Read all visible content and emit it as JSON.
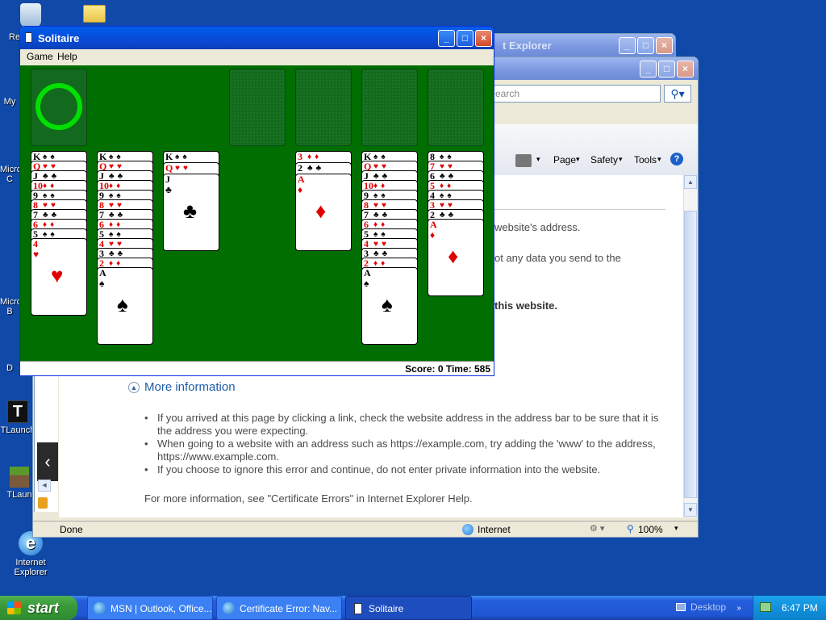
{
  "desktop": {
    "icons": [
      {
        "label": "Re"
      },
      {
        "label": "My"
      },
      {
        "label": "Micro C"
      },
      {
        "label": "Micro B"
      },
      {
        "label": "D"
      },
      {
        "label": "TLaunch"
      },
      {
        "label": "TLaun"
      },
      {
        "label": "Internet Explorer"
      }
    ]
  },
  "ie_back": {
    "title": "t Explorer"
  },
  "ie_front": {
    "search_placeholder": "earch",
    "toolbar": {
      "page": "Page",
      "safety": "Safety",
      "tools": "Tools"
    },
    "content": {
      "line1": "website's address.",
      "line2": "ot any data you send to the",
      "line3": "this website.",
      "more_info": "More information",
      "bullets": [
        "If you arrived at this page by clicking a link, check the website address in the address bar to be sure that it is the address you were expecting.",
        "When going to a website with an address such as https://example.com, try adding the 'www' to the address, https://www.example.com.",
        "If you choose to ignore this error and continue, do not enter private information into the website."
      ],
      "footer": "For more information, see \"Certificate Errors\" in Internet Explorer Help."
    },
    "status": {
      "done": "Done",
      "zone": "Internet",
      "zoom": "100%"
    }
  },
  "solitaire": {
    "title": "Solitaire",
    "menu": [
      "Game",
      "Help"
    ],
    "score": "Score: 0 Time: 585",
    "tableau": [
      [
        "K",
        "Q",
        "J",
        "10",
        "9",
        "8",
        "7",
        "6",
        "5",
        "4"
      ],
      [
        "K",
        "Q",
        "J",
        "10",
        "9",
        "8",
        "7",
        "6",
        "5",
        "4",
        "3",
        "2",
        "A"
      ],
      [
        "K",
        "Q",
        "J"
      ],
      [],
      [
        "3",
        "2",
        "A"
      ],
      [
        "K",
        "Q",
        "J",
        "10",
        "9",
        "8",
        "7",
        "6",
        "5",
        "4",
        "3",
        "2",
        "A"
      ],
      [
        "8",
        "7",
        "6",
        "5",
        "4",
        "3",
        "2",
        "A"
      ]
    ],
    "suit_colors": {
      "red": "#E00000",
      "black": "#000000",
      "felt": "#006E00"
    }
  },
  "taskbar": {
    "start": "start",
    "tasks": [
      "MSN | Outlook, Office...",
      "Certificate Error: Nav...",
      "Solitaire"
    ],
    "desktop_label": "Desktop",
    "clock": "6:47 PM"
  }
}
